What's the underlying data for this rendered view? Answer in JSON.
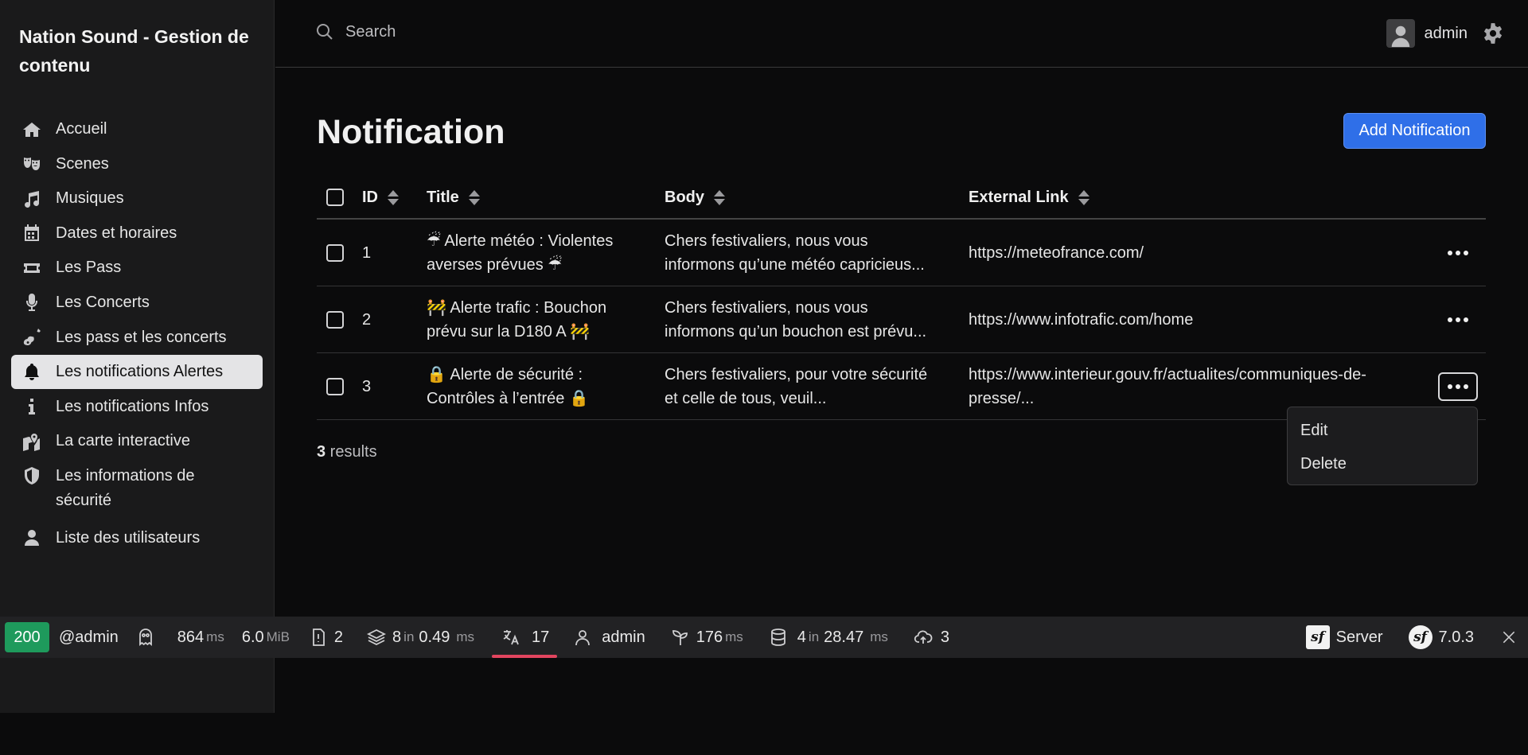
{
  "brand": "Nation Sound - Gestion de contenu",
  "sidebar": {
    "items": [
      {
        "label": "Accueil",
        "icon": "home-icon"
      },
      {
        "label": "Scenes",
        "icon": "theater-masks-icon"
      },
      {
        "label": "Musiques",
        "icon": "music-note-icon"
      },
      {
        "label": "Dates et horaires",
        "icon": "calendar-icon"
      },
      {
        "label": "Les Pass",
        "icon": "ticket-icon"
      },
      {
        "label": "Les Concerts",
        "icon": "microphone-icon"
      },
      {
        "label": "Les pass et les concerts",
        "icon": "guitar-icon"
      },
      {
        "label": "Les notifications Alertes",
        "icon": "bell-icon",
        "active": true
      },
      {
        "label": "Les notifications Infos",
        "icon": "info-icon"
      },
      {
        "label": "La carte interactive",
        "icon": "map-icon"
      },
      {
        "label": "Les informations de sécurité",
        "icon": "shield-icon"
      },
      {
        "label": "Liste des utilisateurs",
        "icon": "user-icon"
      }
    ]
  },
  "header": {
    "search_placeholder": "Search",
    "username": "admin"
  },
  "main": {
    "title": "Notification",
    "add_button": "Add Notification",
    "columns": {
      "id": "ID",
      "title": "Title",
      "body": "Body",
      "link": "External Link"
    },
    "rows": [
      {
        "id": "1",
        "title_1": "☔ Alerte météo : Violentes",
        "title_2": "averses prévues ☔",
        "body_1": "Chers festivaliers, nous vous",
        "body_2": "informons qu’une météo capricieus...",
        "link_1": "https://meteofrance.com/",
        "link_2": ""
      },
      {
        "id": "2",
        "title_1": "🚧 Alerte trafic : Bouchon",
        "title_2": "prévu sur la D180 A 🚧",
        "body_1": "Chers festivaliers, nous vous",
        "body_2": "informons qu’un bouchon est prévu...",
        "link_1": "https://www.infotrafic.com/home",
        "link_2": ""
      },
      {
        "id": "3",
        "title_1": "🔒 Alerte de sécurité :",
        "title_2": "Contrôles à l’entrée 🔒",
        "body_1": "Chers festivaliers, pour votre sécurité",
        "body_2": "et celle de tous, veuil...",
        "link_1": "https://www.interieur.gouv.fr/actualites/communiques-de-",
        "link_2": "presse/..."
      }
    ],
    "results_count": "3",
    "results_label": " results",
    "dropdown": {
      "edit": "Edit",
      "delete": "Delete"
    }
  },
  "toolbar": {
    "status": "200",
    "user_at": "@admin",
    "time_value": "864",
    "time_unit": "ms",
    "memory_value": "6.0",
    "memory_unit": "MiB",
    "logs_count": "2",
    "cache_count": "8",
    "cache_in": "in",
    "cache_time": "0.49",
    "cache_unit": "ms",
    "translation_count": "17",
    "security_user": "admin",
    "twig_value": "176",
    "twig_unit": "ms",
    "db_count": "4",
    "db_in": "in",
    "db_time": "28.47",
    "db_unit": "ms",
    "http_count": "3",
    "server_label": "Server",
    "version": "7.0.3"
  },
  "colors": {
    "accent": "#2f6fe8",
    "status_ok": "#1e9a5c",
    "active_tab": "#e2455f"
  }
}
